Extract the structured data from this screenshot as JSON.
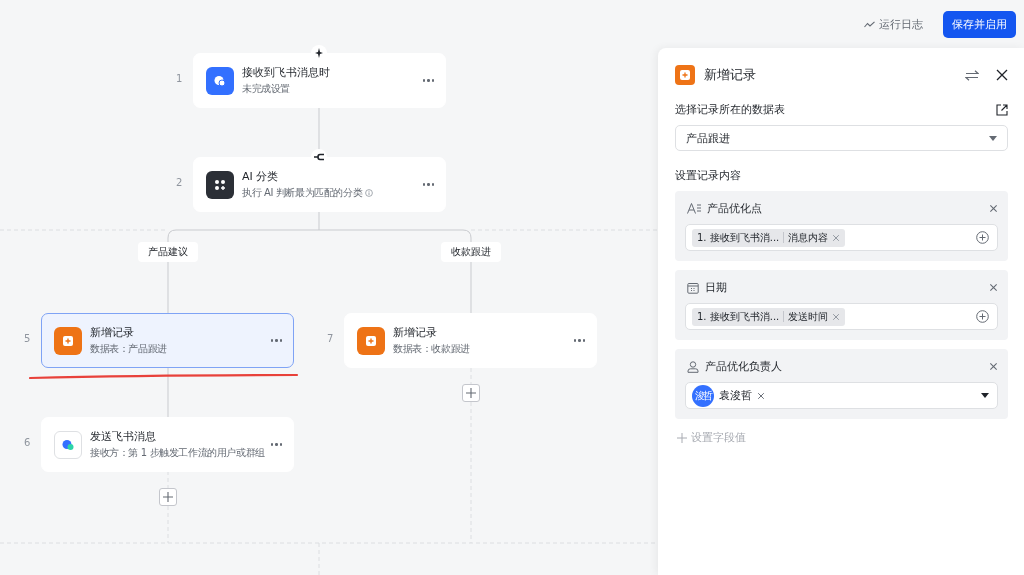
{
  "toolbar": {
    "log_button": "运行日志",
    "save_button": "保存并启用"
  },
  "main_nodes": [
    {
      "number": "1",
      "title": "接收到飞书消息时",
      "subtitle": "未完成设置",
      "kind": "trigger",
      "info": false,
      "selected": false,
      "underlined": false
    },
    {
      "number": "2",
      "title": "AI 分类",
      "subtitle": "执行 AI 判断最为匹配的分类",
      "kind": "ai",
      "info": true,
      "selected": false,
      "underlined": false
    }
  ],
  "branches": [
    {
      "label": "产品建议",
      "nodes": [
        {
          "number": "5",
          "title": "新增记录",
          "subtitle": "数据表：产品跟进",
          "kind": "record",
          "info": false,
          "selected": true,
          "underlined": true
        },
        {
          "number": "6",
          "title": "发送飞书消息",
          "subtitle": "接收方：第 1 步触发工作流的用户或群组",
          "kind": "message",
          "info": false,
          "selected": false,
          "underlined": false
        }
      ]
    },
    {
      "label": "收款跟进",
      "nodes": [
        {
          "number": "7",
          "title": "新增记录",
          "subtitle": "数据表：收款跟进",
          "kind": "record",
          "info": false,
          "selected": false,
          "underlined": false
        }
      ]
    }
  ],
  "panel": {
    "title": "新增记录",
    "table_label": "选择记录所在的数据表",
    "table_value": "产品跟进",
    "content_label": "设置记录内容",
    "fields": [
      {
        "kind": "text",
        "name": "产品优化点",
        "tokens": [
          {
            "source": "1. 接收到飞书消...",
            "field": "消息内容"
          }
        ]
      },
      {
        "kind": "date",
        "name": "日期",
        "tokens": [
          {
            "source": "1. 接收到飞书消...",
            "field": "发送时间"
          }
        ]
      },
      {
        "kind": "person",
        "name": "产品优化负责人",
        "people": [
          {
            "avatar": "浚哲",
            "name": "袁浚哲"
          }
        ]
      }
    ],
    "add_field": "设置字段值"
  }
}
